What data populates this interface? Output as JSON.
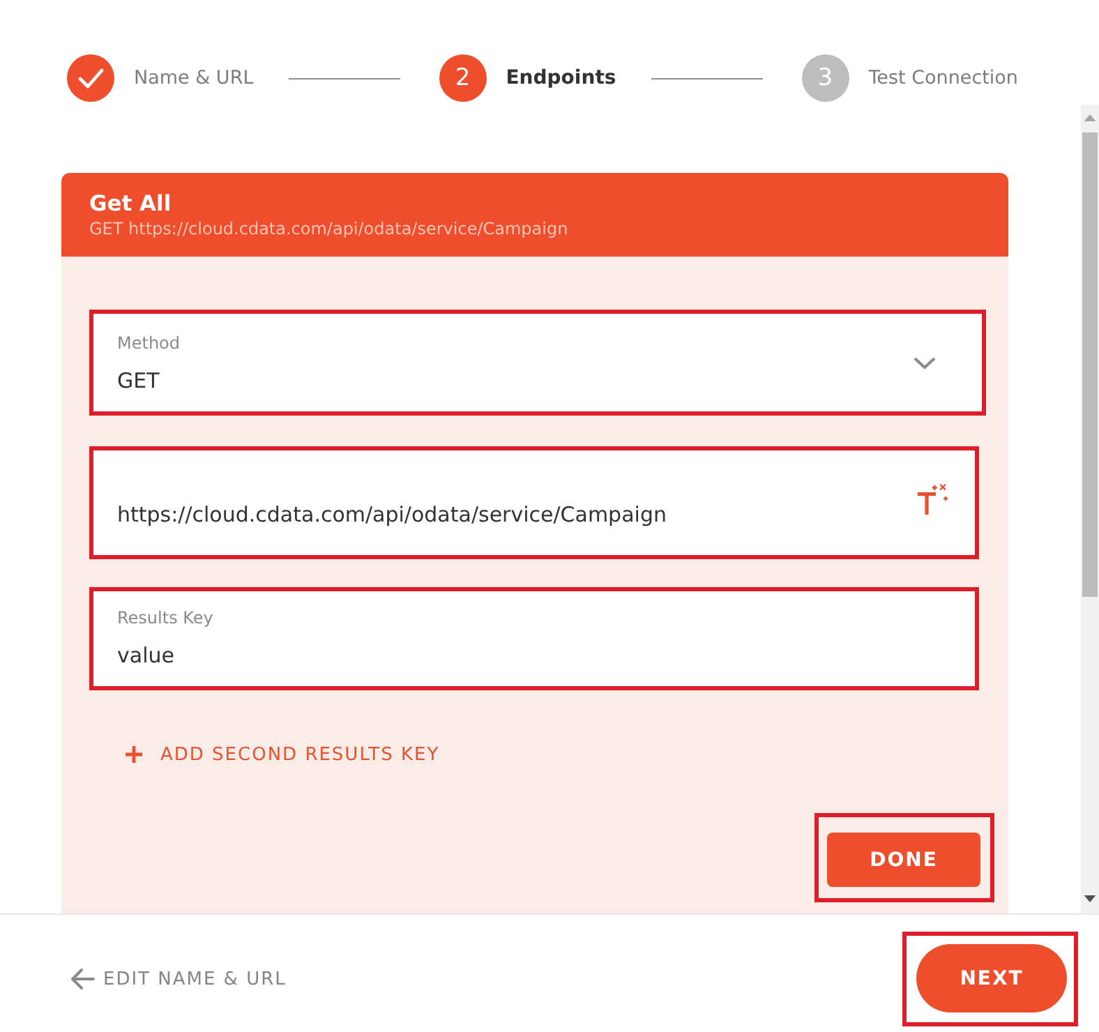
{
  "stepper": {
    "steps": [
      {
        "label": "Name & URL",
        "completed": true,
        "selected": false
      },
      {
        "number": "2",
        "label": "Endpoints",
        "completed": false,
        "selected": true
      },
      {
        "number": "3",
        "label": "Test Connection",
        "completed": false,
        "selected": false
      }
    ]
  },
  "endpoint": {
    "title": "Get All",
    "subtitle": "GET https://cloud.cdata.com/api/odata/service/Campaign"
  },
  "fields": [
    {
      "kind": "select",
      "label": "Method",
      "value": "GET",
      "highlighted": true
    },
    {
      "kind": "url",
      "value": "https://cloud.cdata.com/api/odata/service/Campaign",
      "highlighted": true
    },
    {
      "kind": "text",
      "label": "Results Key",
      "value": "value",
      "highlighted": true
    }
  ],
  "add_key_link": {
    "label": "ADD SECOND RESULTS KEY"
  },
  "done_button": {
    "label": "DONE",
    "highlighted": true
  },
  "footer": {
    "back_link": "EDIT NAME & URL",
    "next_button": {
      "label": "NEXT",
      "highlighted": true
    }
  }
}
